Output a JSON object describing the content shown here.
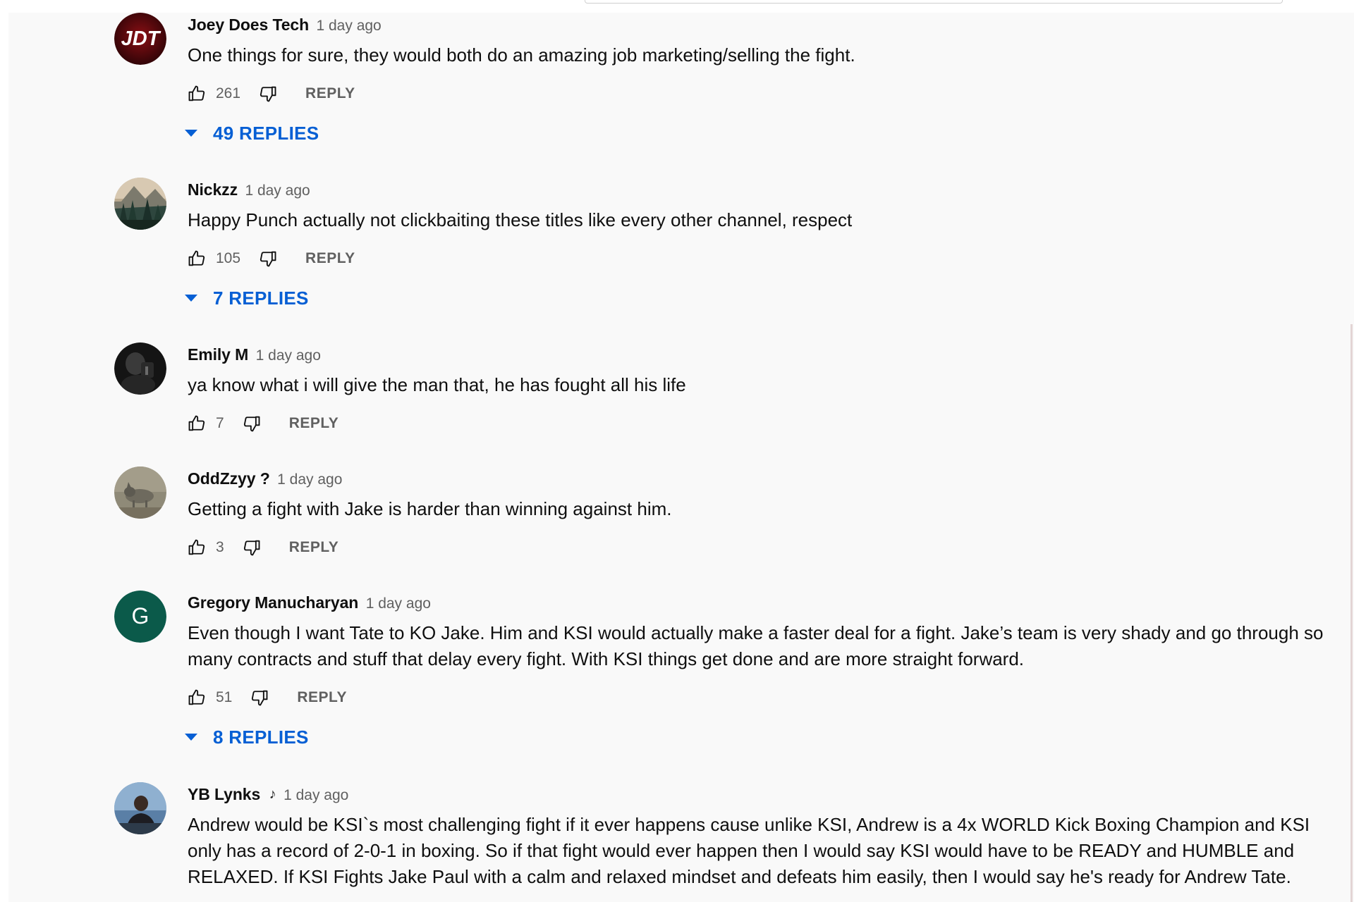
{
  "comments": [
    {
      "author": "Joey Does Tech",
      "time": "1 day ago",
      "text": "One things for sure, they would both do an amazing job marketing/selling the fight.",
      "likes": "261",
      "reply_label": "REPLY",
      "replies_label": "49 REPLIES",
      "avatar": "jdt-logo-avatar",
      "avatar_text": "JDT"
    },
    {
      "author": "Nickzz",
      "time": "1 day ago",
      "text": "Happy Punch actually not clickbaiting these titles like every other channel, respect",
      "likes": "105",
      "reply_label": "REPLY",
      "replies_label": "7 REPLIES",
      "avatar": "mountain-landscape-avatar"
    },
    {
      "author": "Emily M",
      "time": "1 day ago",
      "text": "ya know what i will give the man that, he has fought all his life",
      "likes": "7",
      "reply_label": "REPLY",
      "avatar": "dark-photo-avatar"
    },
    {
      "author": "OddZzyy ?",
      "time": "1 day ago",
      "text": "Getting a fight with Jake is harder than winning against him.",
      "likes": "3",
      "reply_label": "REPLY",
      "avatar": "animal-photo-avatar"
    },
    {
      "author": "Gregory Manucharyan",
      "time": "1 day ago",
      "text": "Even though I want Tate to KO Jake. Him and KSI would actually make a faster deal for a fight. Jake’s team is very shady and go through so many contracts and stuff that delay every fight. With KSI things get done and are more straight forward.",
      "likes": "51",
      "reply_label": "REPLY",
      "replies_label": "8 REPLIES",
      "avatar": "letter-avatar",
      "avatar_text": "G",
      "avatar_color": "#0b5a4a"
    },
    {
      "author": "YB Lynks",
      "badge": "♪",
      "time": "1 day ago",
      "text": "Andrew would be KSI`s most challenging fight if it ever happens cause unlike KSI, Andrew is a 4x WORLD Kick Boxing Champion and KSI only has a record of 2-0-1 in boxing. So if that fight would ever happen then I would say KSI would have to be READY and HUMBLE and RELAXED. If KSI Fights Jake Paul with a calm and relaxed mindset and defeats him easily, then I would say he's ready for Andrew Tate.",
      "avatar": "person-photo-avatar"
    }
  ],
  "colors": {
    "link_blue": "#065fd4",
    "meta_gray": "#606060",
    "text_black": "#0f0f0f",
    "background": "#f9f9f9"
  },
  "icons": {
    "like": "thumbs-up-icon",
    "dislike": "thumbs-down-icon",
    "expand": "caret-down-icon"
  }
}
